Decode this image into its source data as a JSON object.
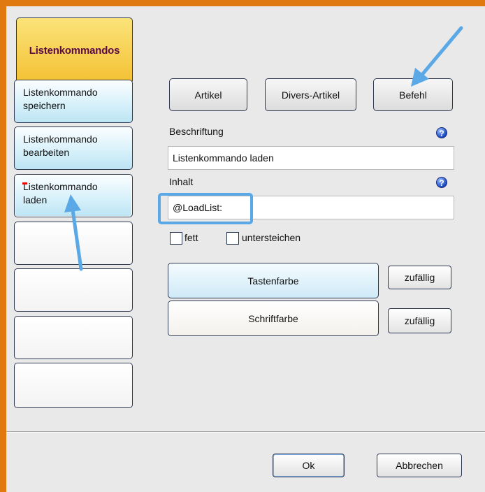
{
  "sidebar": {
    "header": "Listenkommandos",
    "items": [
      {
        "label_line1": "Listenkommando",
        "label_line2": "speichern"
      },
      {
        "label_line1": "Listenkommando",
        "label_line2": "bearbeiten"
      },
      {
        "label_line1": "Listenkommando",
        "label_line2": "laden"
      }
    ]
  },
  "type_buttons": {
    "article": "Artikel",
    "misc_article": "Divers-Artikel",
    "command": "Befehl"
  },
  "caption": {
    "label": "Beschriftung",
    "value": "Listenkommando laden"
  },
  "content": {
    "label": "Inhalt",
    "value": "@LoadList:"
  },
  "help_glyph": "?",
  "options": {
    "bold": "fett",
    "underline": "untersteichen"
  },
  "colors": {
    "key_color": "Tastenfarbe",
    "font_color": "Schriftfarbe",
    "random": "zufällig",
    "accent_border": "#e07a10",
    "highlight_blue": "#5aa8e6"
  },
  "footer": {
    "ok": "Ok",
    "cancel": "Abbrechen"
  }
}
